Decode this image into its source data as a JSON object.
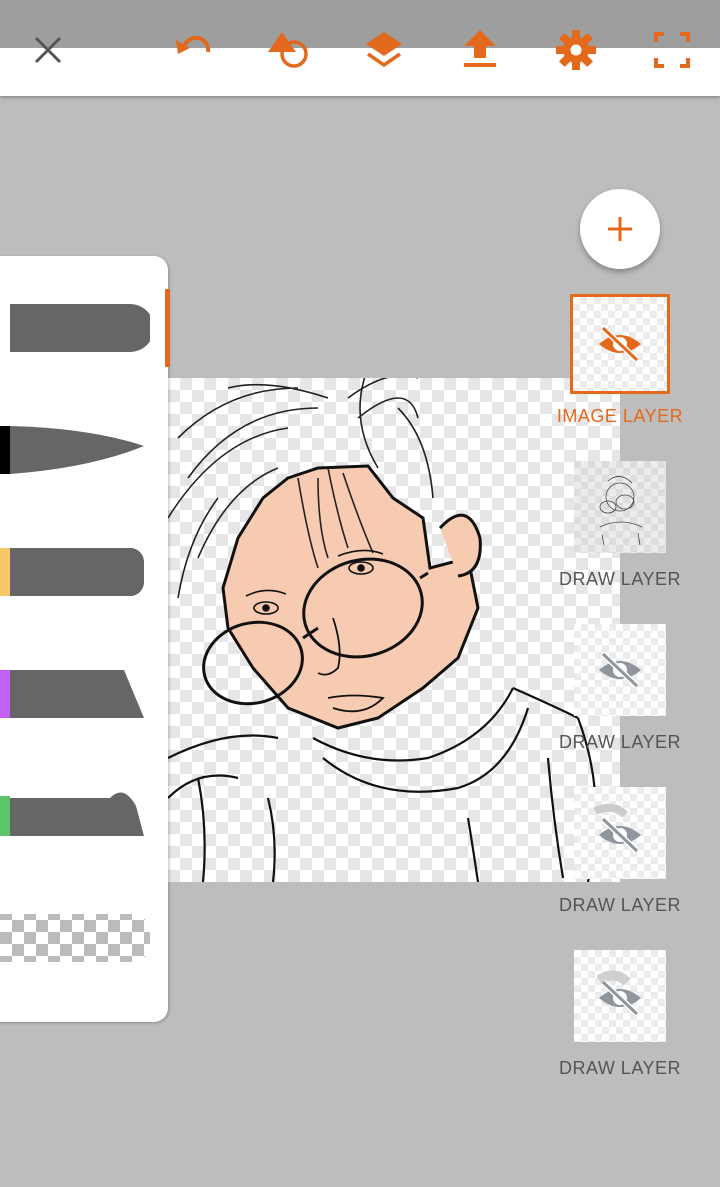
{
  "toolbar": {
    "icons": [
      "close-icon",
      "undo-icon",
      "shape-fill-icon",
      "layers-icon",
      "upload-icon",
      "gear-icon",
      "fullscreen-icon"
    ],
    "accent": "#e36a1c"
  },
  "brushes": {
    "items": [
      {
        "name": "flat",
        "color": "#666666"
      },
      {
        "name": "pointed",
        "color": "#000000"
      },
      {
        "name": "round",
        "color": "#f7c86a"
      },
      {
        "name": "chisel",
        "color": "#c061f2"
      },
      {
        "name": "taper",
        "color": "#5cc46a"
      },
      {
        "name": "eraser",
        "color": "transparent"
      }
    ]
  },
  "layers": {
    "add_label": "+",
    "items": [
      {
        "label": "IMAGE LAYER",
        "selected": true
      },
      {
        "label": "DRAW LAYER",
        "selected": false
      },
      {
        "label": "DRAW LAYER",
        "selected": false
      },
      {
        "label": "DRAW LAYER",
        "selected": false
      },
      {
        "label": "DRAW LAYER",
        "selected": false
      }
    ]
  }
}
